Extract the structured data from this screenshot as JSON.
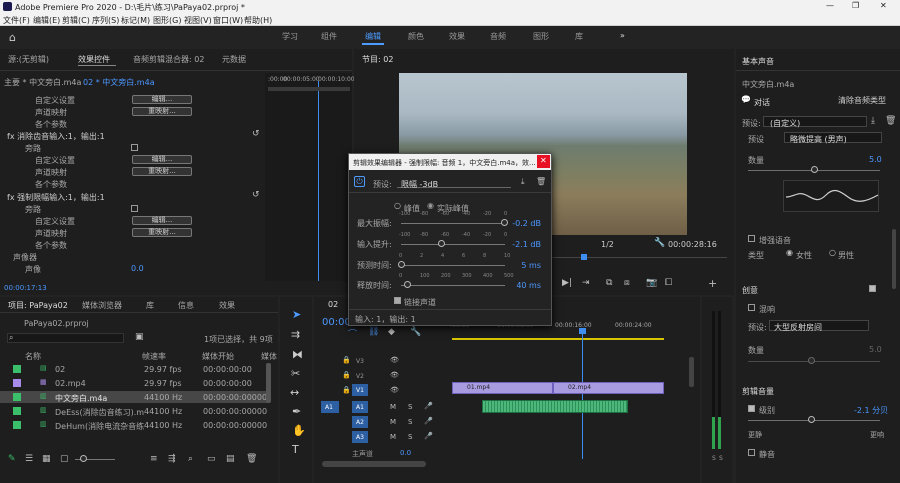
{
  "app": {
    "title": "Adobe Premiere Pro 2020 - D:\\毛片\\练习\\PaPaya02.prproj *",
    "window_controls": [
      "—",
      "❐",
      "✕"
    ]
  },
  "menu": [
    "文件(F)",
    "编辑(E)",
    "剪辑(C)",
    "序列(S)",
    "标记(M)",
    "图形(G)",
    "视图(V)",
    "窗口(W)",
    "帮助(H)"
  ],
  "workspaces": {
    "items": [
      "学习",
      "组件",
      "编辑",
      "颜色",
      "效果",
      "音频",
      "图形",
      "库"
    ],
    "active": "编辑",
    "more": "»"
  },
  "source_panel": {
    "tabs": [
      "源:(无剪辑)",
      "效果控件",
      "音频剪辑混合器: 02",
      "元数据"
    ],
    "active_tab": "效果控件",
    "clip_path": "主要 * 中文旁白.m4a",
    "seq_clip": "02 * 中文旁白.m4a",
    "ruler": [
      ":00:00",
      "00:00:05:00",
      "00:00:10:00"
    ],
    "rows": [
      "自定义设置",
      "声道映射",
      "各个参数"
    ],
    "edit_btn": "编辑...",
    "remap_btn": "重映射...",
    "effect1": "fx 消除齿音输入:1，输出:1",
    "effect2": "fx 强制限幅输入:1，输出:1",
    "bypass": "旁路",
    "panner": "声像器",
    "balance": "声像",
    "balance_value": "0.0",
    "timecode": "00:00:17:13"
  },
  "program": {
    "title": "节目: 02",
    "timecode": "00:00:28:16",
    "zoom": "1/2"
  },
  "dialog": {
    "title": "剪辑效果编辑器 - 强制限幅: 音频 1，中文旁白.m4a，效...",
    "close": "✕",
    "preset_label": "预设:",
    "preset_value": "限幅 -3dB",
    "radio1": "峰值",
    "radio2": "实际峰值",
    "ticks": [
      "-100",
      "-80",
      "-60",
      "-40",
      "-20",
      "0"
    ],
    "params": [
      {
        "label": "最大振幅:",
        "value": "-0.2 dB"
      },
      {
        "label": "输入提升:",
        "value": "-2.1 dB"
      },
      {
        "label": "预测时间:",
        "value": "5 ms"
      },
      {
        "label": "释放时间:",
        "value": "40 ms"
      }
    ],
    "time_ticks": [
      "0",
      "2",
      "4",
      "6",
      "8",
      "10"
    ],
    "release_ticks": [
      "0",
      "100",
      "200",
      "300",
      "400",
      "500"
    ],
    "link": "链接声道",
    "io": "输入: 1，输出: 1"
  },
  "project": {
    "tabs": [
      "项目: PaPaya02",
      "媒体浏览器",
      "库",
      "信息",
      "效果"
    ],
    "file": "PaPaya02.prproj",
    "status": "1项已选择，共 9项",
    "columns": [
      "名称",
      "帧速率",
      "媒体开始",
      "媒体"
    ],
    "rows": [
      {
        "name": "02",
        "rate": "29.97 fps",
        "start": "00:00:00:00",
        "color": "#3cbf6a"
      },
      {
        "name": "02.mp4",
        "rate": "29.97 fps",
        "start": "00:00:00:00",
        "color": "#a78be8"
      },
      {
        "name": "中文旁白.m4a",
        "rate": "44100 Hz",
        "start": "00:00:00:00000",
        "color": "#3cbf6a"
      },
      {
        "name": "DeEss(消除齿音练习).m",
        "rate": "44100 Hz",
        "start": "00:00:00:00000",
        "color": "#3cbf6a"
      },
      {
        "name": "DeHum(消除电流杂音练",
        "rate": "44100 Hz",
        "start": "00:00:00:00000",
        "color": "#3cbf6a"
      }
    ]
  },
  "timeline": {
    "tab": "02",
    "timecode": "00:00",
    "ruler": [
      ":00:00",
      "00:00:08:00",
      "00:00:16:00",
      "00:00:24:00"
    ],
    "tracks": [
      "V3",
      "V2",
      "V1",
      "A1",
      "A2",
      "A3"
    ],
    "source_a1": "A1",
    "master": "主声道",
    "master_value": "0.0",
    "clip_v1a": "01.mp4",
    "clip_v1b": "02.mp4",
    "meter_labels": [
      "S",
      "S"
    ]
  },
  "essential_sound": {
    "title": "基本声音",
    "clip": "中文旁白.m4a",
    "type": "对话",
    "clear_btn": "清除音频类型",
    "preset_label": "预设:",
    "preset": "(自定义)",
    "pre_label": "预设",
    "pre_value": "略微提高 (男声)",
    "amount": "数量",
    "amount_value": "5.0",
    "enhance": "增强语音",
    "type_label": "类型",
    "female": "女性",
    "male": "男性",
    "creative": "创意",
    "reverb": "混响",
    "reverb_preset_label": "预设:",
    "reverb_preset": "大型反射房间",
    "amount2": "数量",
    "amount2_value": "5.0",
    "clip_volume": "剪辑音量",
    "level": "级别",
    "level_value": "-2.1 分贝",
    "quieter": "更静",
    "louder": "更响",
    "mute": "静音"
  }
}
